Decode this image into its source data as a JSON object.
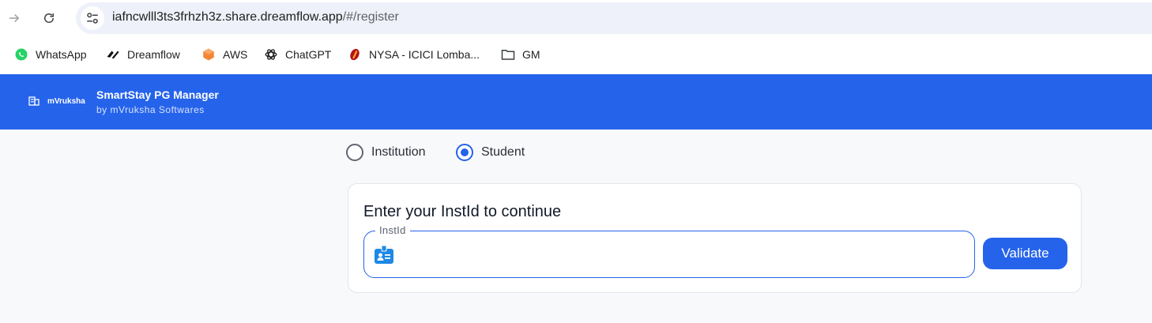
{
  "browser": {
    "url_host": "iafncwlll3ts3frhzh3z.share.dreamflow.app",
    "url_path": "/#/register",
    "bookmarks": [
      {
        "label": "WhatsApp",
        "icon": "whatsapp-icon"
      },
      {
        "label": "Dreamflow",
        "icon": "dreamflow-icon"
      },
      {
        "label": "AWS",
        "icon": "aws-icon"
      },
      {
        "label": "ChatGPT",
        "icon": "chatgpt-icon"
      },
      {
        "label": "NYSA - ICICI Lomba...",
        "icon": "icici-icon"
      },
      {
        "label": "GM",
        "icon": "folder-icon"
      }
    ]
  },
  "header": {
    "logo_text": "mVruksha",
    "title": "SmartStay PG Manager",
    "subtitle": "by mVruksha Softwares"
  },
  "role": {
    "options": [
      {
        "label": "Institution",
        "selected": false
      },
      {
        "label": "Student",
        "selected": true
      }
    ]
  },
  "card": {
    "title": "Enter your InstId to continue",
    "field_label": "InstId",
    "field_value": "",
    "validate_label": "Validate"
  },
  "colors": {
    "primary": "#2563eb",
    "page_bg": "#f8f9fb"
  }
}
